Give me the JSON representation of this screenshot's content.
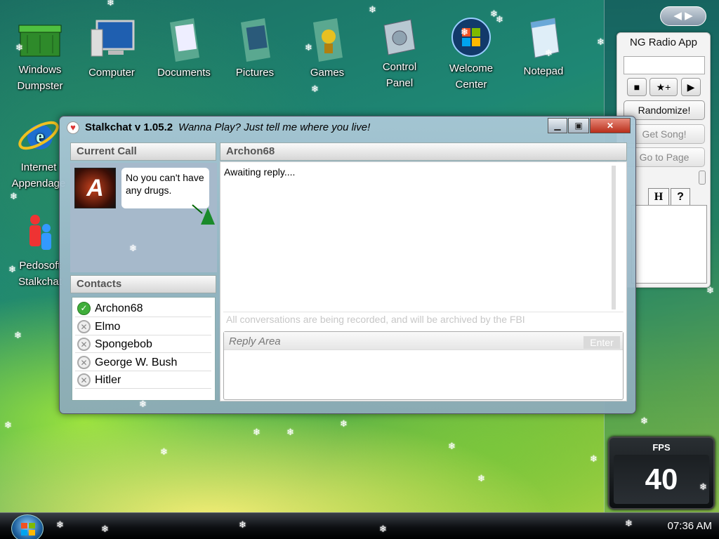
{
  "desktop": {
    "icons": [
      {
        "label": "Windows\nDumpster",
        "icon": "recycle-bin-icon"
      },
      {
        "label": "Computer",
        "icon": "computer-icon"
      },
      {
        "label": "Documents",
        "icon": "documents-icon"
      },
      {
        "label": "Pictures",
        "icon": "pictures-icon"
      },
      {
        "label": "Games",
        "icon": "games-icon"
      },
      {
        "label": "Control\nPanel",
        "icon": "control-panel-icon"
      },
      {
        "label": "Welcome\nCenter",
        "icon": "welcome-center-icon"
      },
      {
        "label": "Notepad",
        "icon": "notepad-icon"
      },
      {
        "label": "Internet\nAppendage",
        "icon": "internet-explorer-icon"
      },
      {
        "label": "Pedosoft\nStalkchat",
        "icon": "people-icon"
      }
    ]
  },
  "radio": {
    "title": "NG Radio App",
    "search_value": "",
    "randomize": "Randomize!",
    "get_song": "Get Song!",
    "go_to_page": "Go to Page",
    "tab_h": "H",
    "tab_help": "?"
  },
  "fps": {
    "label": "FPS",
    "value": "40"
  },
  "taskbar": {
    "clock": "07:36 AM"
  },
  "chat": {
    "title": "Stalkchat v 1.05.2",
    "subtitle": "Wanna Play?  Just tell me where you live!",
    "current_call_header": "Current Call",
    "call_avatar_letter": "A",
    "call_message": "No you can't have any drugs.",
    "contacts_header": "Contacts",
    "contacts": [
      {
        "name": "Archon68",
        "status": "online"
      },
      {
        "name": "Elmo",
        "status": "offline"
      },
      {
        "name": "Spongebob",
        "status": "offline"
      },
      {
        "name": "George W. Bush",
        "status": "offline"
      },
      {
        "name": "Hitler",
        "status": "offline"
      }
    ],
    "conversation_header": "Archon68",
    "conversation_text": "Awaiting reply....",
    "archive_notice": "All conversations are being recorded, and will be archived by the FBI",
    "reply_placeholder": "Reply Area",
    "enter_label": "Enter"
  }
}
